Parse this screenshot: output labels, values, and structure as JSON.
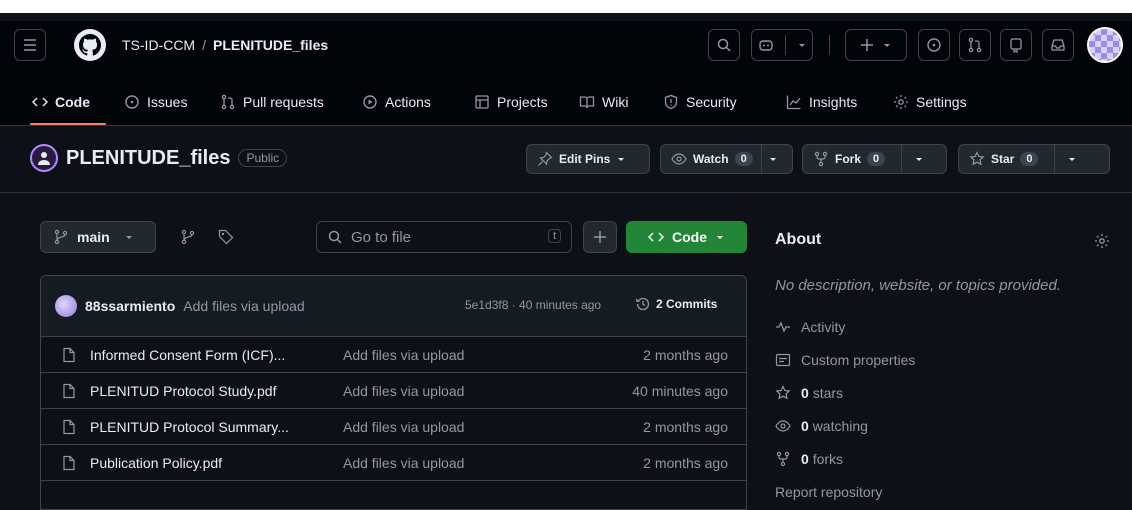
{
  "header": {
    "owner": "TS-ID-CCM",
    "separator": "/",
    "repo": "PLENITUDE_files"
  },
  "tabs": [
    {
      "label": "Code",
      "icon": "code-icon"
    },
    {
      "label": "Issues",
      "icon": "issue-icon"
    },
    {
      "label": "Pull requests",
      "icon": "pull-request-icon"
    },
    {
      "label": "Actions",
      "icon": "play-icon"
    },
    {
      "label": "Projects",
      "icon": "table-icon"
    },
    {
      "label": "Wiki",
      "icon": "book-icon"
    },
    {
      "label": "Security",
      "icon": "shield-icon"
    },
    {
      "label": "Insights",
      "icon": "graph-icon"
    },
    {
      "label": "Settings",
      "icon": "gear-icon"
    }
  ],
  "repo_header": {
    "name": "PLENITUDE_files",
    "visibility": "Public",
    "edit_pins": "Edit Pins",
    "watch": "Watch",
    "watch_count": "0",
    "fork": "Fork",
    "fork_count": "0",
    "star": "Star",
    "star_count": "0"
  },
  "toolbar": {
    "branch": "main",
    "go_to_file": "Go to file",
    "shortcut": "t",
    "code": "Code"
  },
  "latest_commit": {
    "author": "88ssarmiento",
    "message": "Add files via upload",
    "meta": "5e1d3f8 · 40 minutes ago",
    "commits": "2 Commits"
  },
  "files": [
    {
      "name": "Informed Consent Form (ICF)...",
      "message": "Add files via upload",
      "date": "2 months ago"
    },
    {
      "name": "PLENITUD Protocol Study.pdf",
      "message": "Add files via upload",
      "date": "40 minutes ago"
    },
    {
      "name": "PLENITUD Protocol Summary...",
      "message": "Add files via upload",
      "date": "2 months ago"
    },
    {
      "name": "Publication Policy.pdf",
      "message": "Add files via upload",
      "date": "2 months ago"
    }
  ],
  "about": {
    "title": "About",
    "description": "No description, website, or topics provided.",
    "activity": "Activity",
    "custom_properties": "Custom properties",
    "stars_count": "0",
    "stars_label": "stars",
    "watching_count": "0",
    "watching_label": "watching",
    "forks_count": "0",
    "forks_label": "forks",
    "report": "Report repository"
  },
  "colors": {
    "background": "#0d1117",
    "header": "#010409",
    "accent_underline": "#f78166",
    "code_button": "#238636"
  }
}
